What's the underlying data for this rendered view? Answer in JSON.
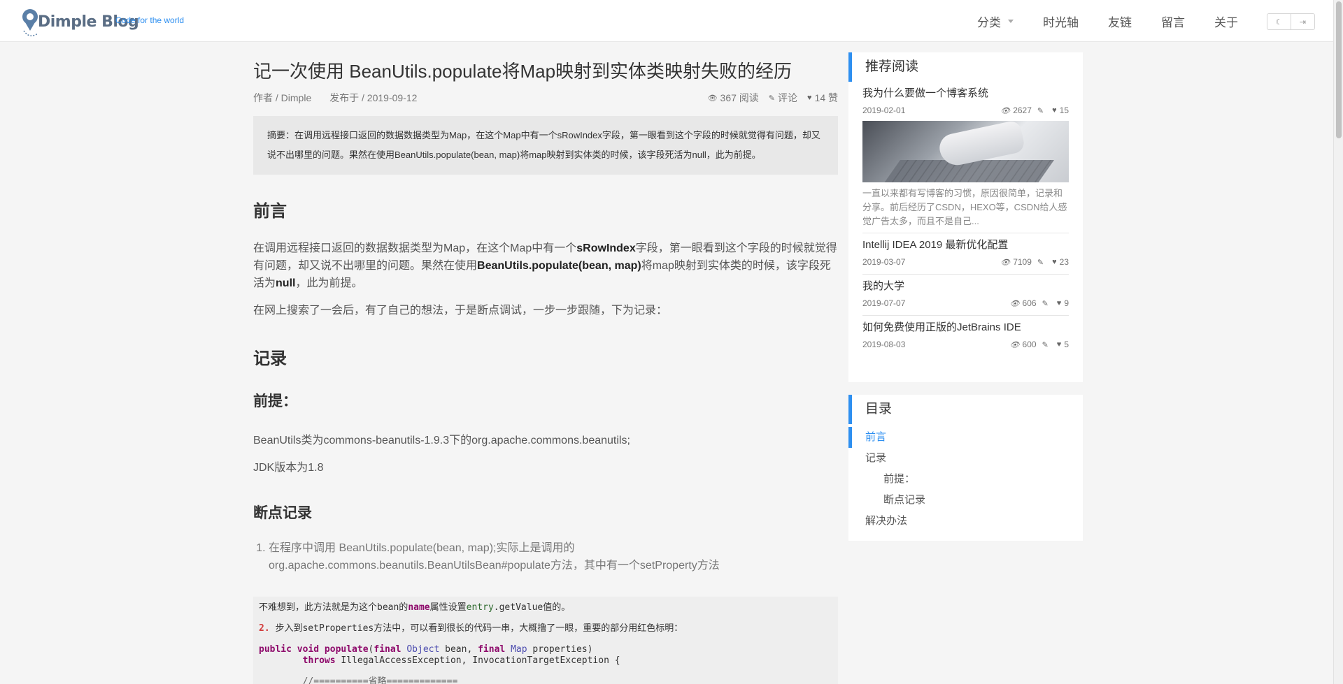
{
  "header": {
    "logo_text": "Dimple Blog",
    "slogan": "Code for the world",
    "nav": [
      "分类",
      "时光轴",
      "友链",
      "留言",
      "关于"
    ],
    "toggle_icons": [
      "moon-icon",
      "login-icon"
    ]
  },
  "article": {
    "title": "记一次使用 BeanUtils.populate将Map映射到实体类映射失败的经历",
    "author": "作者 / Dimple",
    "published": "发布于 / 2019-09-12",
    "views": "367 阅读",
    "comments": "评论",
    "likes": "14 赞",
    "summary": "摘要：在调用远程接口返回的数据数据类型为Map，在这个Map中有一个sRowIndex字段，第一眼看到这个字段的时候就觉得有问题，却又说不出哪里的问题。果然在使用BeanUtils.populate(bean, map)将map映射到实体类的时候，该字段死活为null，此为前提。",
    "h_preface": "前言",
    "preface_p1_a": "在调用远程接口返回的数据数据类型为Map，在这个Map中有一个",
    "preface_p1_b": "sRowIndex",
    "preface_p1_c": "字段，第一眼看到这个字段的时候就觉得有问题，却又说不出哪里的问题。果然在使用",
    "preface_p1_d": "BeanUtils.populate(bean, map)",
    "preface_p1_e": "将map映射到实体类的时候，该字段死活为",
    "preface_p1_f": "null",
    "preface_p1_g": "，此为前提。",
    "preface_p2": "在网上搜索了一会后，有了自己的想法，于是断点调试，一步一步跟随，下为记录：",
    "h_record": "记录",
    "h_premise": "前提：",
    "premise_p1": "BeanUtils类为commons-beanutils-1.9.3下的org.apache.commons.beanutils;",
    "premise_p2": "JDK版本为1.8",
    "h_breakpoint": "断点记录",
    "step1_a": "在程序中调用 BeanUtils.populate(bean, map);实际上是调用的",
    "step1_b": "org.apache.commons.beanutils.BeanUtilsBean#populate方法，其中有一个setProperty方法",
    "code": {
      "l1_a": "不难想到，此方法就是为这个bean的",
      "l1_b": "name",
      "l1_c": "属性设置",
      "l1_d": "entry",
      "l1_e": ".getValue值的。",
      "l2_a": "2.",
      "l2_b": " 步入到setProperties方法中，可以看到很长的代码一串，大概撸了一眼，重要的部分用红色标明：",
      "l3_a": "public void",
      "l3_b": "populate",
      "l3_c": "(",
      "l3_d": "final",
      "l3_e": " Object",
      "l3_f": " bean, ",
      "l3_g": "final",
      "l3_h": " Map",
      "l3_i": " properties)",
      "l4_a": "        throws",
      "l4_b": " IllegalAccessException, InvocationTargetException {",
      "l5": "        //==========省略============="
    }
  },
  "sidebar": {
    "recommend_title": "推荐阅读",
    "recommend": [
      {
        "title": "我为什么要做一个博客系统",
        "date": "2019-02-01",
        "views": "2627",
        "likes": "15",
        "desc": "一直以来都有写博客的习惯，原因很简单，记录和分享。前后经历了CSDN，HEXO等，CSDN给人感觉广告太多，而且不是自己..."
      },
      {
        "title": "Intellij IDEA 2019 最新优化配置",
        "date": "2019-03-07",
        "views": "7109",
        "likes": "23"
      },
      {
        "title": "我的大学",
        "date": "2019-07-07",
        "views": "606",
        "likes": "9"
      },
      {
        "title": "如何免费使用正版的JetBrains IDE",
        "date": "2019-08-03",
        "views": "600",
        "likes": "5"
      }
    ],
    "toc_title": "目录",
    "toc": [
      "前言",
      "记录",
      "前提：",
      "断点记录",
      "解决办法"
    ]
  },
  "colors": {
    "accent": "#2e8ff0",
    "background": "#f5f5f5"
  }
}
